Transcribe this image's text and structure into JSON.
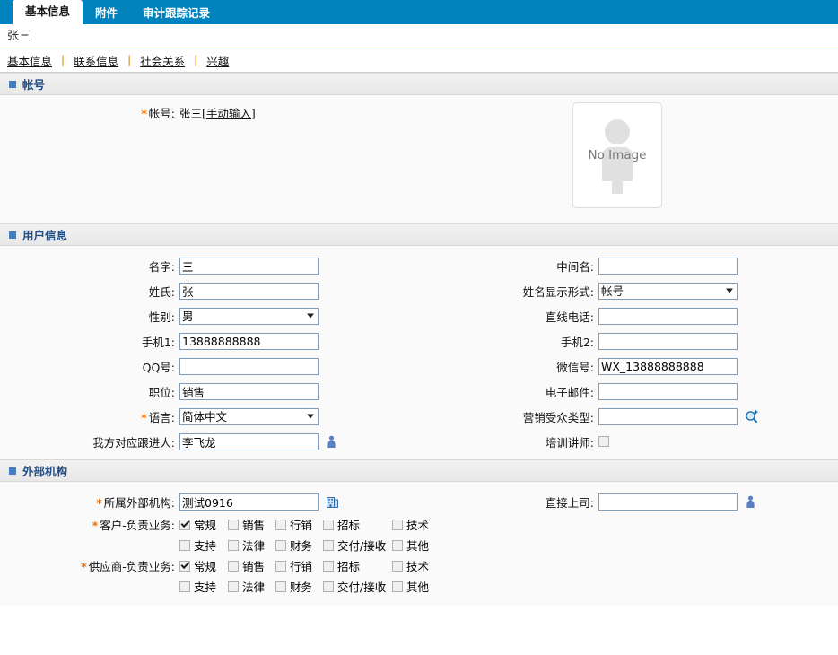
{
  "tabs": [
    {
      "label": "基本信息",
      "active": true
    },
    {
      "label": "附件",
      "active": false
    },
    {
      "label": "审计跟踪记录",
      "active": false
    }
  ],
  "record_title": "张三",
  "subnav": [
    {
      "label": "基本信息"
    },
    {
      "label": "联系信息"
    },
    {
      "label": "社会关系"
    },
    {
      "label": "兴趣"
    }
  ],
  "subnav_separator": "|",
  "sections": {
    "account": {
      "title": "帐号",
      "field_label": "帐号:",
      "value_text": "张三",
      "value_link": "[手动输入]",
      "required": "*",
      "image_placeholder": "No Image"
    },
    "user_info": {
      "title": "用户信息",
      "left": [
        {
          "label": "名字:",
          "value": "三",
          "type": "text",
          "required": false
        },
        {
          "label": "姓氏:",
          "value": "张",
          "type": "text",
          "required": false
        },
        {
          "label": "性别:",
          "value": "男",
          "type": "select",
          "required": false
        },
        {
          "label": "手机1:",
          "value": "13888888888",
          "type": "text",
          "required": false
        },
        {
          "label": "QQ号:",
          "value": "",
          "type": "text",
          "required": false
        },
        {
          "label": "职位:",
          "value": "销售",
          "type": "text",
          "required": false
        },
        {
          "label": "语言:",
          "value": "简体中文",
          "type": "select",
          "required": true
        },
        {
          "label": "我方对应跟进人:",
          "value": "李飞龙",
          "type": "text",
          "required": false,
          "icon": "person-picker-icon"
        }
      ],
      "right": [
        {
          "label": "中间名:",
          "value": "",
          "type": "text",
          "required": false
        },
        {
          "label": "姓名显示形式:",
          "value": "帐号",
          "type": "select",
          "required": false
        },
        {
          "label": "直线电话:",
          "value": "",
          "type": "text",
          "required": false
        },
        {
          "label": "手机2:",
          "value": "",
          "type": "text",
          "required": false
        },
        {
          "label": "微信号:",
          "value": "WX_13888888888",
          "type": "text",
          "required": false
        },
        {
          "label": "电子邮件:",
          "value": "",
          "type": "text",
          "required": false
        },
        {
          "label": "营销受众类型:",
          "value": "",
          "type": "text",
          "required": false,
          "icon": "search-add-icon"
        },
        {
          "label": "培训讲师:",
          "value": "",
          "type": "checkbox",
          "required": false,
          "checked": false
        }
      ]
    },
    "external_org": {
      "title": "外部机构",
      "org_field": {
        "label": "所属外部机构:",
        "value": "测试0916",
        "required": true,
        "icon": "building-icon"
      },
      "supervisor_field": {
        "label": "直接上司:",
        "value": "",
        "required": false,
        "icon": "person-picker-icon"
      },
      "customer_duty": {
        "label": "客户-负责业务:",
        "required": true,
        "row1": [
          {
            "label": "常规",
            "checked": true
          },
          {
            "label": "销售",
            "checked": false
          },
          {
            "label": "行销",
            "checked": false
          },
          {
            "label": "招标",
            "checked": false
          },
          {
            "label": "技术",
            "checked": false
          }
        ],
        "row2": [
          {
            "label": "支持",
            "checked": false
          },
          {
            "label": "法律",
            "checked": false
          },
          {
            "label": "财务",
            "checked": false
          },
          {
            "label": "交付/接收",
            "checked": false
          },
          {
            "label": "其他",
            "checked": false
          }
        ]
      },
      "supplier_duty": {
        "label": "供应商-负责业务:",
        "required": true,
        "row1": [
          {
            "label": "常规",
            "checked": true
          },
          {
            "label": "销售",
            "checked": false
          },
          {
            "label": "行销",
            "checked": false
          },
          {
            "label": "招标",
            "checked": false
          },
          {
            "label": "技术",
            "checked": false
          }
        ],
        "row2": [
          {
            "label": "支持",
            "checked": false
          },
          {
            "label": "法律",
            "checked": false
          },
          {
            "label": "财务",
            "checked": false
          },
          {
            "label": "交付/接收",
            "checked": false
          },
          {
            "label": "其他",
            "checked": false
          }
        ]
      }
    }
  },
  "colors": {
    "header_blue": "#0082bd",
    "section_title": "#1f4e88",
    "required_star": "#e8700a",
    "input_border": "#7f9db9",
    "separator": "#c8860a"
  }
}
